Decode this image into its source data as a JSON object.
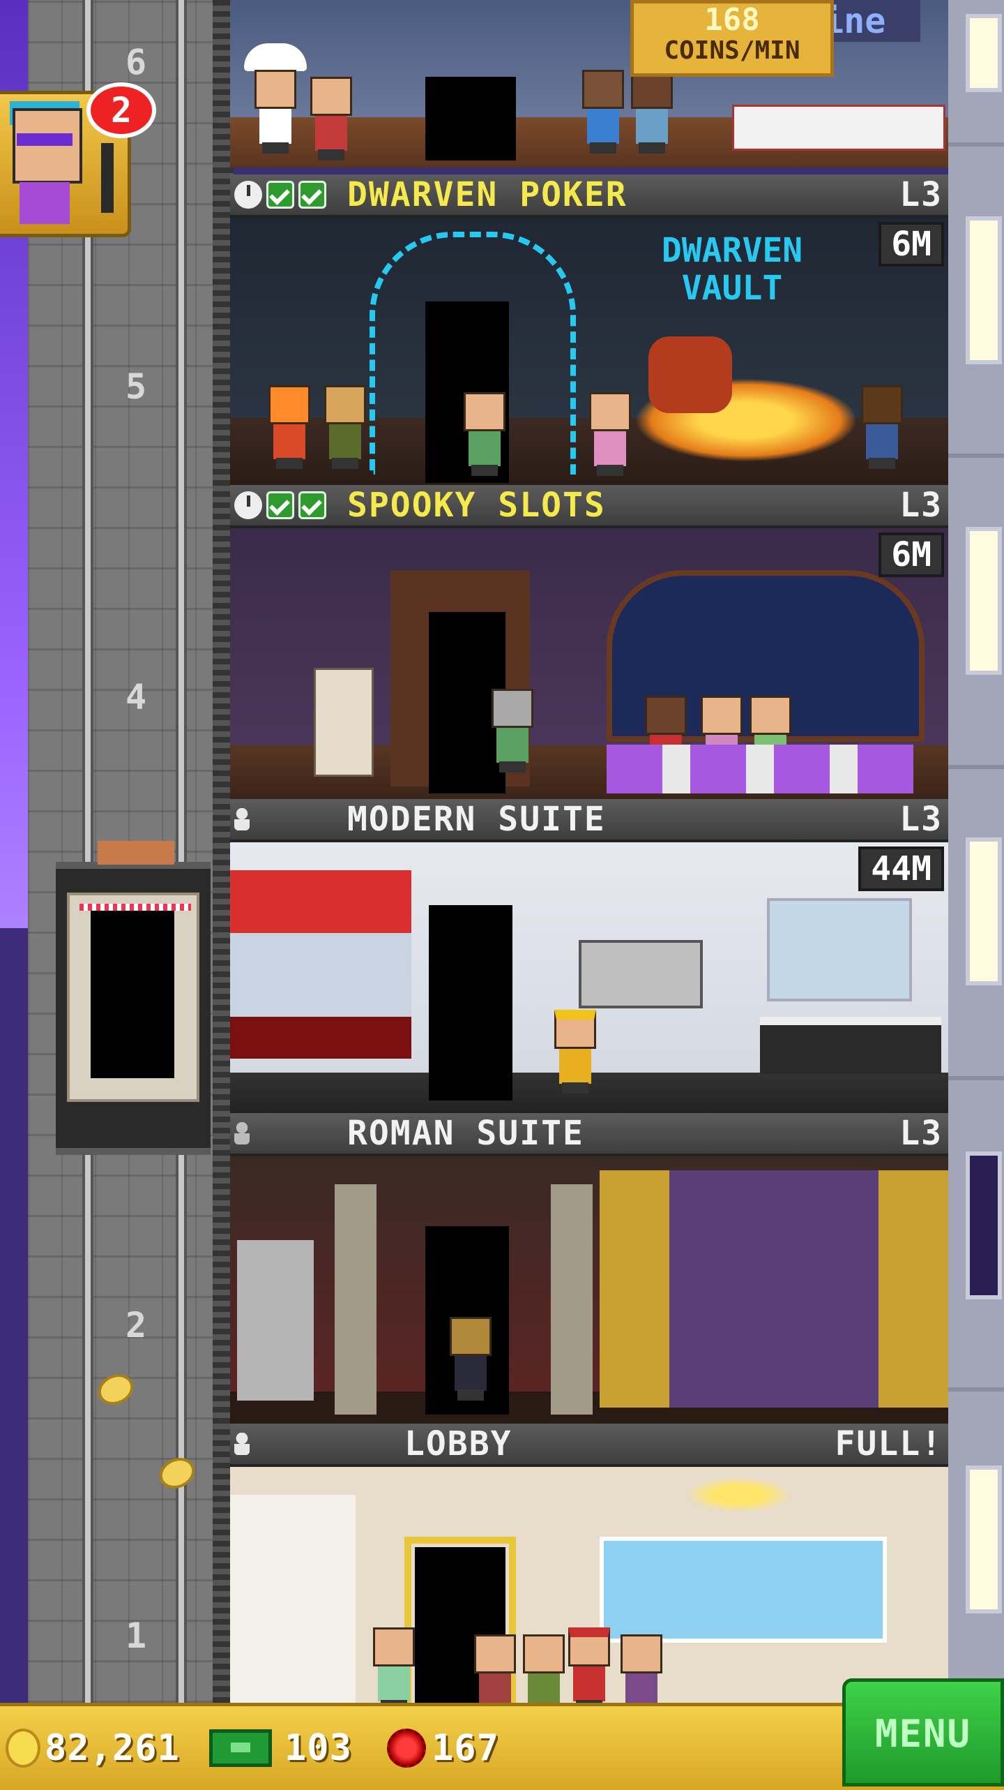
{
  "top_floor": {
    "coin_rate_value": "168",
    "coin_rate_unit": "COINS/MIN",
    "sign": "Cuisine"
  },
  "notification": {
    "badge_count": "2"
  },
  "shaft_numbers": [
    "6",
    "5",
    "4",
    "2",
    "1"
  ],
  "floors": [
    {
      "name": "DWARVEN POKER",
      "level": "L3",
      "badge": "6M",
      "sign": "DWARVEN VAULT"
    },
    {
      "name": "SPOOKY SLOTS",
      "level": "L3",
      "badge": "6M"
    },
    {
      "name": "MODERN SUITE",
      "level": "L3",
      "badge": "44M"
    },
    {
      "name": "ROMAN SUITE",
      "level": "L3"
    },
    {
      "name": "LOBBY",
      "level": "FULL!"
    }
  ],
  "bottom_bar": {
    "coins": "82,261",
    "bux": "103",
    "gems": "167",
    "menu_label": "MENU"
  },
  "colors": {
    "header_gold_text": "#f6e94b",
    "menu_green": "#2ebd3a",
    "bottom_bar_gold": "#e8bf35"
  }
}
